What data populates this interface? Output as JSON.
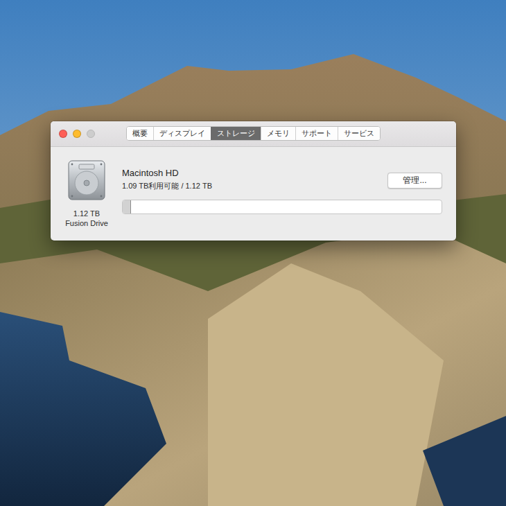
{
  "window": {
    "controls": [
      {
        "kind": "close",
        "enabled": true,
        "color": "#fe5f57"
      },
      {
        "kind": "minimize",
        "enabled": true,
        "color": "#febc2e"
      },
      {
        "kind": "zoom",
        "enabled": false,
        "color": "#cdcdcd"
      }
    ]
  },
  "tabs": [
    {
      "label": "概要",
      "selected": false
    },
    {
      "label": "ディスプレイ",
      "selected": false
    },
    {
      "label": "ストレージ",
      "selected": true
    },
    {
      "label": "メモリ",
      "selected": false
    },
    {
      "label": "サポート",
      "selected": false
    },
    {
      "label": "サービス",
      "selected": false
    }
  ],
  "disk": {
    "name": "Macintosh HD",
    "summary": "1.09 TB利用可能 / 1.12 TB",
    "capacity": "1.12 TB",
    "type": "Fusion Drive",
    "level": 0.027
  },
  "buttons": [
    "管理..."
  ]
}
